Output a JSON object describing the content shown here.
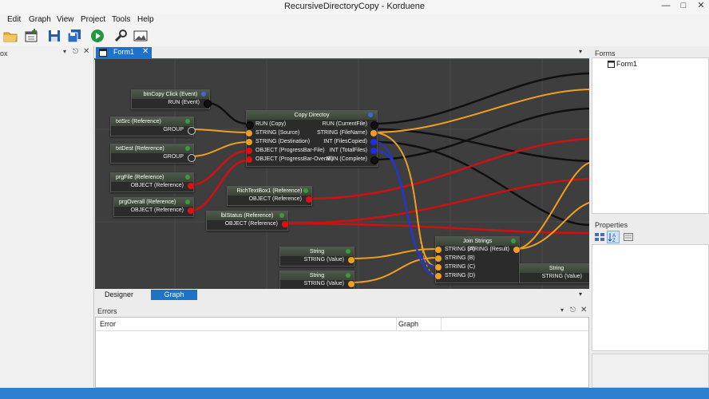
{
  "window": {
    "title": "RecursiveDirectoryCopy - Korduene"
  },
  "menu": [
    "Edit",
    "Graph",
    "View",
    "Project",
    "Tools",
    "Help"
  ],
  "toolbar": {
    "buttons": [
      "open-folder-icon",
      "new-form-icon",
      "save-icon",
      "save-all-icon",
      "run-icon",
      "settings-wrench-icon",
      "image-icon"
    ]
  },
  "left_panel": {
    "title_fragment": "ox"
  },
  "document_tab": {
    "label": "Form1"
  },
  "graph": {
    "nodes": {
      "btnCopy": {
        "title": "btnCopy Click (Event)",
        "rows": [
          "RUN (Event)"
        ]
      },
      "txtSrc": {
        "title": "txtSrc (Reference)",
        "rows": [
          "GROUP"
        ]
      },
      "txtDest": {
        "title": "txtDest (Reference)",
        "rows": [
          "GROUP"
        ]
      },
      "prgFile": {
        "title": "prgFile (Reference)",
        "rows": [
          "OBJECT (Reference)"
        ]
      },
      "prgOverall": {
        "title": "prgOverall (Reference)",
        "rows": [
          "OBJECT (Reference)"
        ]
      },
      "copyDir": {
        "title": "Copy Directoy",
        "inputs": [
          "RUN (Copy)",
          "STRING (Source)",
          "STRING (Destination)",
          "OBJECT (ProgressBar-File)",
          "OBJECT (ProgressBar-Overall)"
        ],
        "outputs": [
          "RUN (CurrentFile)",
          "STRING (FileName)",
          "INT (FilesCopied)",
          "INT (TotalFiles)",
          "RUN (Complete)"
        ]
      },
      "richText": {
        "title": "RichTextBox1 (Reference)",
        "rows": [
          "OBJECT (Reference)"
        ]
      },
      "lblStatus": {
        "title": "lblStatus (Reference)",
        "rows": [
          "OBJECT (Reference)"
        ]
      },
      "string1": {
        "title": "String",
        "rows": [
          "STRING (Value)"
        ]
      },
      "string2": {
        "title": "String",
        "rows": [
          "STRING (Value)"
        ]
      },
      "joinStrings": {
        "title": "Join Strings",
        "inputs": [
          "STRING (A)",
          "STRING (B)",
          "STRING (C)",
          "STRING (D)"
        ],
        "outputs": [
          "STRING (Result)"
        ]
      },
      "string3": {
        "title": "String",
        "rows": [
          "STRING (Value)"
        ]
      }
    }
  },
  "bottom_tabs": [
    "Designer",
    "Graph"
  ],
  "errors": {
    "title": "Errors",
    "columns": [
      "Error",
      "Graph"
    ]
  },
  "forms_panel": {
    "title": "Forms",
    "items": [
      "Form1"
    ]
  },
  "properties_panel": {
    "title": "Properties"
  },
  "colors": {
    "accent": "#1e73c8",
    "run": "#111111",
    "string": "#f0a020",
    "object": "#e01010",
    "int": "#1a2ee8",
    "group": "#2b2b2b"
  }
}
